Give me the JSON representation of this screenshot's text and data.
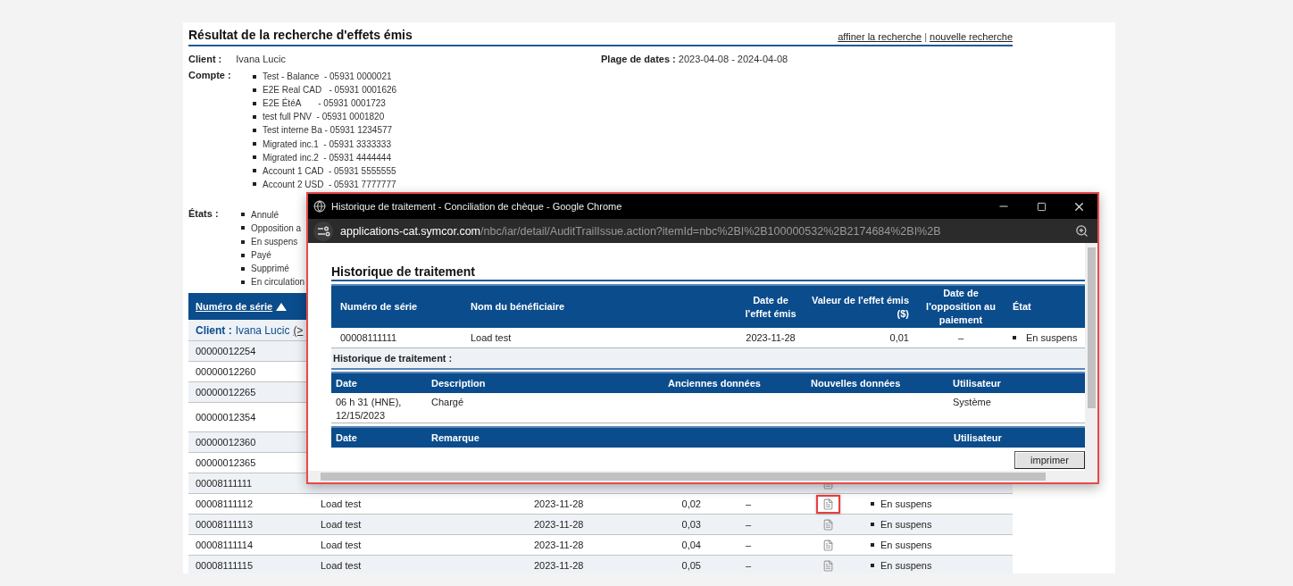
{
  "page": {
    "title": "Résultat de la recherche d'effets émis",
    "links": [
      {
        "label": "affiner la recherche"
      },
      {
        "label": "nouvelle recherche"
      }
    ],
    "link_separator": "|",
    "client": {
      "label": "Client :",
      "value": "Ivana Lucic"
    },
    "date_range": {
      "label": "Plage de dates :",
      "value": "2023-04-08 - 2024-04-08"
    },
    "accounts": {
      "label": "Compte :",
      "items": [
        "Test - Balance  - 05931 0000021",
        "E2E Real CAD   - 05931 0001626",
        "E2E ÉtéA       - 05931 0001723",
        "test full PNV  - 05931 0001820",
        "Test interne Ba - 05931 1234577",
        "Migrated inc.1  - 05931 3333333",
        "Migrated inc.2  - 05931 4444444",
        "Account 1 CAD  - 05931 5555555",
        "Account 2 USD  - 05931 7777777"
      ]
    },
    "states": {
      "label": "États :",
      "items": [
        "Annulé",
        "Opposition a",
        "En suspens",
        "Payé",
        "Supprimé",
        "En circulation"
      ]
    },
    "table": {
      "columns": [
        {
          "label": "Numéro de série",
          "sorted": true
        }
      ],
      "group": {
        "label": "Client :",
        "value": "Ivana Lucic",
        "link": "(>"
      },
      "rows": [
        {
          "serial": "00000012254"
        },
        {
          "serial": "00000012260"
        },
        {
          "serial": "00000012265"
        },
        {
          "serial": "00000012354"
        },
        {
          "serial": "00000012360"
        },
        {
          "serial": "00000012365"
        },
        {
          "serial": "00008111111",
          "document": true,
          "highlighted": false
        },
        {
          "serial": "00008111112",
          "beneficiary": "Load test",
          "date": "2023-11-28",
          "value": "0,02",
          "opposition": "–",
          "document": true,
          "status": "En suspens",
          "highlighted": true
        },
        {
          "serial": "00008111113",
          "beneficiary": "Load test",
          "date": "2023-11-28",
          "value": "0,03",
          "opposition": "–",
          "document": true,
          "status": "En suspens",
          "highlighted": false
        },
        {
          "serial": "00008111114",
          "beneficiary": "Load test",
          "date": "2023-11-28",
          "value": "0,04",
          "opposition": "–",
          "document": true,
          "status": "En suspens",
          "highlighted": false
        },
        {
          "serial": "00008111115",
          "beneficiary": "Load test",
          "date": "2023-11-28",
          "value": "0,05",
          "opposition": "–",
          "document": true,
          "status": "En suspens",
          "highlighted": false
        }
      ]
    }
  },
  "popup": {
    "window_title": "Historique de traitement - Conciliation de chèque - Google Chrome",
    "url_domain": "applications-cat.symcor.com",
    "url_path": "/nbc/iar/detail/AuditTrailIssue.action?itemId=nbc%2BI%2B100000532%2B2174684%2BI%2B",
    "heading": "Historique de traitement",
    "item_table": {
      "columns": [
        "Numéro de série",
        "Nom du bénéficiaire",
        "Date de l'effet émis",
        "Valeur de l'effet émis ($)",
        "Date de l'opposition au paiement",
        "État"
      ],
      "row": {
        "serial": "00008111111",
        "beneficiary": "Load test",
        "date": "2023-11-28",
        "value": "0,01",
        "opposition": "–",
        "status": "En suspens"
      }
    },
    "history_label": "Historique de traitement :",
    "history_table": {
      "columns": [
        "Date",
        "Description",
        "Anciennes données",
        "Nouvelles données",
        "Utilisateur"
      ],
      "rows": [
        {
          "date": "06 h 31 (HNE), 12/15/2023",
          "description": "Chargé",
          "user": "Système"
        }
      ]
    },
    "remarks_table": {
      "columns": [
        "Date",
        "Remarque",
        "Utilisateur"
      ]
    },
    "print_button": "imprimer"
  }
}
